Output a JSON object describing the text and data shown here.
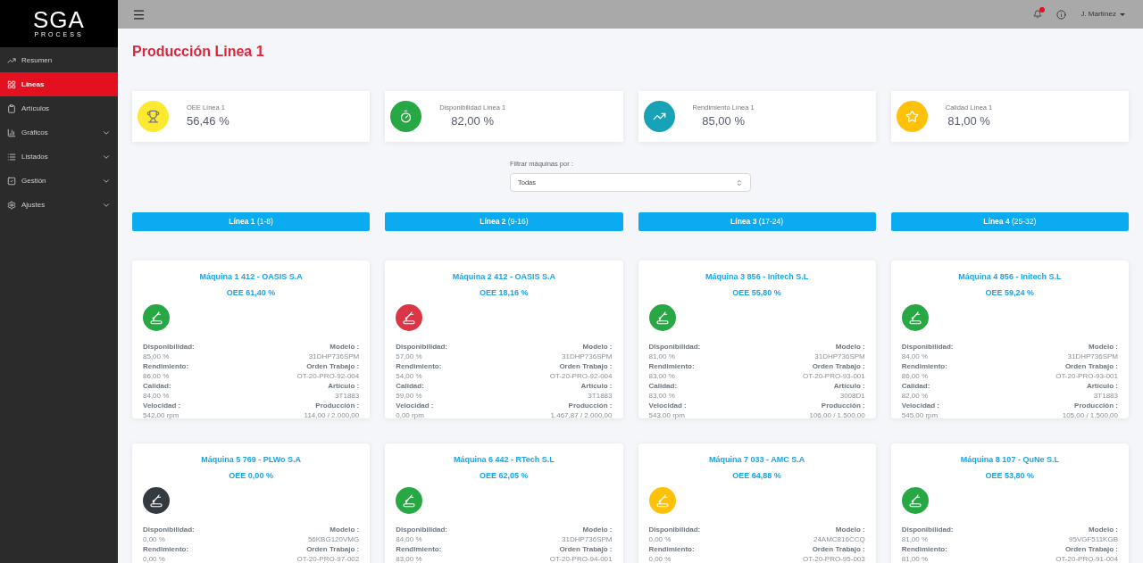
{
  "logo": {
    "title": "SGA",
    "subtitle": "PROCESS"
  },
  "sidebar": {
    "items": [
      {
        "label": "Resumen",
        "selected": false,
        "expandable": false
      },
      {
        "label": "Líneas",
        "selected": true,
        "expandable": false
      },
      {
        "label": "Artículos",
        "selected": false,
        "expandable": false
      },
      {
        "label": "Gráficos",
        "selected": false,
        "expandable": true
      },
      {
        "label": "Listados",
        "selected": false,
        "expandable": true
      },
      {
        "label": "Gestión",
        "selected": false,
        "expandable": true
      },
      {
        "label": "Ajustes",
        "selected": false,
        "expandable": true
      }
    ]
  },
  "topbar": {
    "notification_dot": true,
    "user": "J. Martínez"
  },
  "page_title": "Producción Linea 1",
  "kpis": [
    {
      "color": "#fde92f",
      "label": "OEE Línea 1",
      "value": "56,46 %"
    },
    {
      "color": "#28a745",
      "label": "Disponibilidad Línea 1",
      "value": "82,00 %"
    },
    {
      "color": "#17a2b8",
      "label": "Rendimiento Línea 1",
      "value": "85,00 %"
    },
    {
      "color": "#ffc107",
      "label": "Calidad Línea 1",
      "value": "81,00 %"
    }
  ],
  "filter": {
    "label": "Filtrar máquinas por :",
    "value": "Todas"
  },
  "lines": [
    "**Línea 1** (1-8)",
    "**Línea 2** (9-16)",
    "**Línea 3** (17-24)",
    "**Línea 4** (25-32)"
  ],
  "machines": [
    {
      "title": "Máquina 1 412 - OASIS S.A",
      "oee": "OEE 61,40 %",
      "color": "#28a745",
      "left": [
        {
          "label": "Disponibilidad:",
          "value": "85,00 %"
        },
        {
          "label": "Rendimiento:",
          "value": "86,00 %"
        },
        {
          "label": "Calidad:",
          "value": "84,00 %"
        },
        {
          "label": "Velocidad :",
          "value": "542,00 rpm"
        }
      ],
      "right": [
        {
          "label": "Modelo :",
          "value": "31DHP736SPM"
        },
        {
          "label": "Orden Trabajo :",
          "value": "OT-20-PRO-92-004"
        },
        {
          "label": "Artículo :",
          "value": "3T1883"
        },
        {
          "label": "Producción :",
          "value": "114,00 / 2.000,00"
        }
      ]
    },
    {
      "title": "Máquina 2 412 - OASIS S.A",
      "oee": "OEE 18,16 %",
      "color": "#dc3545",
      "left": [
        {
          "label": "Disponibilidad:",
          "value": "57,00 %"
        },
        {
          "label": "Rendimiento:",
          "value": "54,00 %"
        },
        {
          "label": "Calidad:",
          "value": "59,00 %"
        },
        {
          "label": "Velocidad :",
          "value": "0,00 rpm"
        }
      ],
      "right": [
        {
          "label": "Modelo :",
          "value": "31DHP736SPM"
        },
        {
          "label": "Orden Trabajo :",
          "value": "OT-20-PRO-92-004"
        },
        {
          "label": "Artículo :",
          "value": "3T1883"
        },
        {
          "label": "Producción :",
          "value": "1.467,87 / 2.000,00"
        }
      ]
    },
    {
      "title": "Máquina 3 856 - Initech S.L",
      "oee": "OEE 55,80 %",
      "color": "#28a745",
      "left": [
        {
          "label": "Disponibilidad:",
          "value": "81,00 %"
        },
        {
          "label": "Rendimiento:",
          "value": "83,00 %"
        },
        {
          "label": "Calidad:",
          "value": "83,00 %"
        },
        {
          "label": "Velocidad :",
          "value": "543,00 rpm"
        }
      ],
      "right": [
        {
          "label": "Modelo :",
          "value": "31DHP736SPM"
        },
        {
          "label": "Orden Trabajo :",
          "value": "OT-20-PRO-93-001"
        },
        {
          "label": "Artículo :",
          "value": "3008D1"
        },
        {
          "label": "Producción :",
          "value": "106,00 / 1.500,00"
        }
      ]
    },
    {
      "title": "Máquina 4 856 - Initech S.L",
      "oee": "OEE 59,24 %",
      "color": "#28a745",
      "left": [
        {
          "label": "Disponibilidad:",
          "value": "84,00 %"
        },
        {
          "label": "Rendimiento:",
          "value": "86,00 %"
        },
        {
          "label": "Calidad:",
          "value": "82,00 %"
        },
        {
          "label": "Velocidad :",
          "value": "545,00 rpm"
        }
      ],
      "right": [
        {
          "label": "Modelo :",
          "value": "31DHP736SPM"
        },
        {
          "label": "Orden Trabajo :",
          "value": "OT-20-PRO-93-001"
        },
        {
          "label": "Artículo :",
          "value": "3T1883"
        },
        {
          "label": "Producción :",
          "value": "105,00 / 1.500,00"
        }
      ]
    },
    {
      "title": "Máquina 5 769 - PLWo S.A",
      "oee": "OEE 0,00 %",
      "color": "#343a40",
      "left": [
        {
          "label": "Disponibilidad:",
          "value": "0,00 %"
        },
        {
          "label": "Rendimiento:",
          "value": "0,00 %"
        }
      ],
      "right": [
        {
          "label": "Modelo :",
          "value": "56KBG120VMG"
        },
        {
          "label": "Orden Trabajo :",
          "value": "OT-20-PRO-97-002"
        }
      ]
    },
    {
      "title": "Máquina 6 442 - RTech S.L",
      "oee": "OEE 62,05 %",
      "color": "#28a745",
      "left": [
        {
          "label": "Disponibilidad:",
          "value": "84,00 %"
        },
        {
          "label": "Rendimiento:",
          "value": "83,00 %"
        }
      ],
      "right": [
        {
          "label": "Modelo :",
          "value": "31DHP736SPM"
        },
        {
          "label": "Orden Trabajo :",
          "value": "OT-20-PRO-94-001"
        }
      ]
    },
    {
      "title": "Máquina 7 033 - AMC S.A",
      "oee": "OEE 64,88 %",
      "color": "#ffc107",
      "left": [
        {
          "label": "Disponibilidad:",
          "value": "0,00 %"
        },
        {
          "label": "Rendimiento:",
          "value": "0,00 %"
        }
      ],
      "right": [
        {
          "label": "Modelo :",
          "value": "24AMC816CCQ"
        },
        {
          "label": "Orden Trabajo :",
          "value": "OT-20-PRO-95-003"
        }
      ]
    },
    {
      "title": "Máquina 8 107 - QuNe S.L",
      "oee": "OEE 53,80 %",
      "color": "#28a745",
      "left": [
        {
          "label": "Disponibilidad:",
          "value": "81,00 %"
        },
        {
          "label": "Rendimiento:",
          "value": "81,00 %"
        }
      ],
      "right": [
        {
          "label": "Modelo :",
          "value": "95VGF511KGB"
        },
        {
          "label": "Orden Trabajo :",
          "value": "OT-20-PRO-91-004"
        }
      ]
    }
  ]
}
